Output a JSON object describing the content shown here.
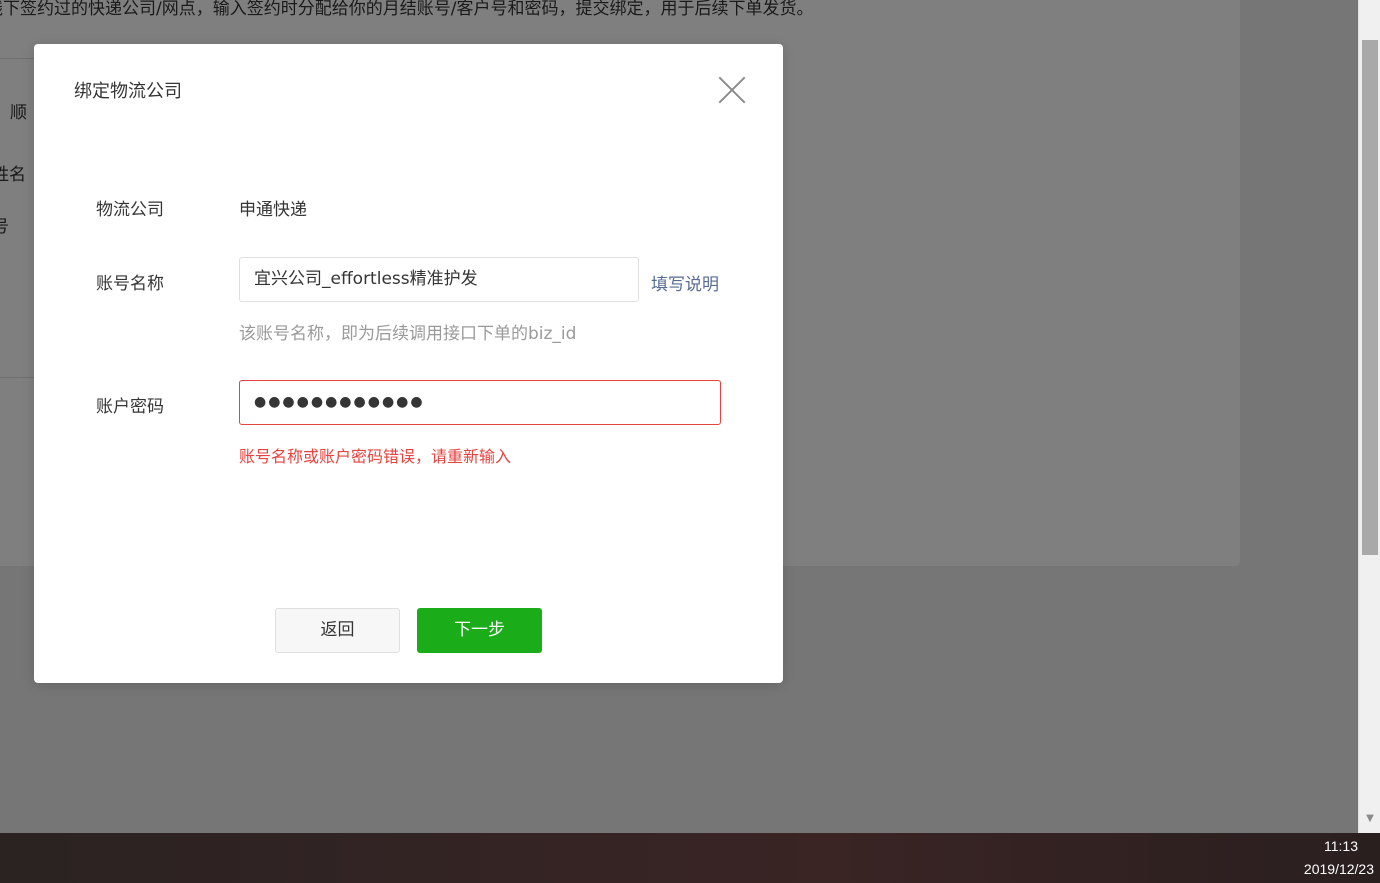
{
  "background": {
    "description": "线下签约过的快递公司/网点，输入签约时分配给你的月结账号/客户号和密码，提交绑定，用于后续下单发货。",
    "fragment_1": "顺",
    "fragment_2": "姓名",
    "fragment_3": "号"
  },
  "dialog": {
    "title": "绑定物流公司",
    "company_label": "物流公司",
    "company_value": "申通快递",
    "account_label": "账号名称",
    "account_value": "宜兴公司_effortless精准护发",
    "help_link": "填写说明",
    "account_hint": "该账号名称，即为后续调用接口下单的biz_id",
    "password_label": "账户密码",
    "password_value": "●●●●●●●●●●●●",
    "error_message": "账号名称或账户密码错误，请重新输入",
    "back_button": "返回",
    "next_button": "下一步"
  },
  "taskbar": {
    "time": "11:13",
    "date": "2019/12/23"
  },
  "colors": {
    "primary_green": "#1aad19",
    "error_red": "#e64340",
    "link_blue": "#576b95"
  }
}
